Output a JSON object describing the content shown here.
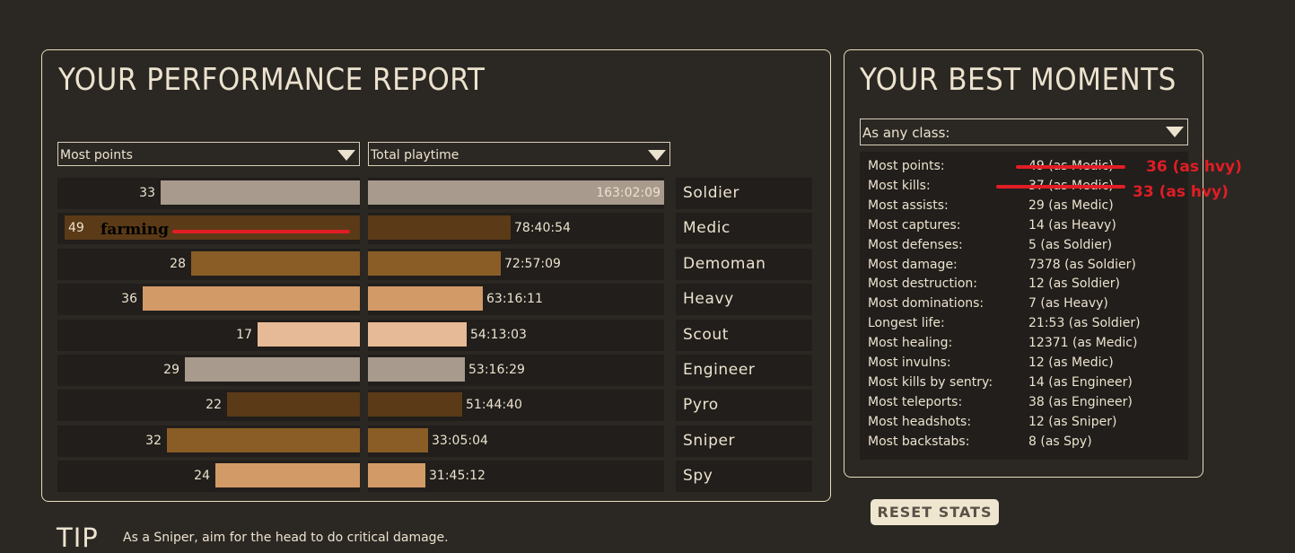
{
  "performance": {
    "title": "YOUR PERFORMANCE REPORT",
    "stat_dropdown": "Most points",
    "time_dropdown": "Total playtime",
    "rows": [
      {
        "class": "Soldier",
        "points": "33",
        "points_value": 33,
        "time": "163:02:09",
        "time_hours": 163.04,
        "color": "#a89a8c"
      },
      {
        "class": "Medic",
        "points": "49",
        "points_value": 49,
        "time": "78:40:54",
        "time_hours": 78.68,
        "color": "#5b3a17"
      },
      {
        "class": "Demoman",
        "points": "28",
        "points_value": 28,
        "time": "72:57:09",
        "time_hours": 72.95,
        "color": "#8a5d26"
      },
      {
        "class": "Heavy",
        "points": "36",
        "points_value": 36,
        "time": "63:16:11",
        "time_hours": 63.27,
        "color": "#d29a67"
      },
      {
        "class": "Scout",
        "points": "17",
        "points_value": 17,
        "time": "54:13:03",
        "time_hours": 54.22,
        "color": "#e6ba96"
      },
      {
        "class": "Engineer",
        "points": "29",
        "points_value": 29,
        "time": "53:16:29",
        "time_hours": 53.27,
        "color": "#a89a8c"
      },
      {
        "class": "Pyro",
        "points": "22",
        "points_value": 22,
        "time": "51:44:40",
        "time_hours": 51.74,
        "color": "#5b3a17"
      },
      {
        "class": "Sniper",
        "points": "32",
        "points_value": 32,
        "time": "33:05:04",
        "time_hours": 33.08,
        "color": "#8a5d26"
      },
      {
        "class": "Spy",
        "points": "24",
        "points_value": 24,
        "time": "31:45:12",
        "time_hours": 31.75,
        "color": "#d29a67"
      }
    ]
  },
  "moments": {
    "title": "YOUR BEST MOMENTS",
    "class_dropdown": "As any class:",
    "items": [
      {
        "label": "Most points:",
        "value": "49 (as Medic)"
      },
      {
        "label": "Most kills:",
        "value": "37 (as Medic)"
      },
      {
        "label": "Most assists:",
        "value": "29 (as Medic)"
      },
      {
        "label": "Most captures:",
        "value": "14 (as Heavy)"
      },
      {
        "label": "Most defenses:",
        "value": "5 (as Soldier)"
      },
      {
        "label": "Most damage:",
        "value": "7378 (as Soldier)"
      },
      {
        "label": "Most destruction:",
        "value": "12 (as Soldier)"
      },
      {
        "label": "Most dominations:",
        "value": "7 (as Heavy)"
      },
      {
        "label": "Longest life:",
        "value": "21:53 (as Soldier)"
      },
      {
        "label": "Most healing:",
        "value": "12371 (as Medic)"
      },
      {
        "label": "Most invulns:",
        "value": "12 (as Medic)"
      },
      {
        "label": "Most kills by sentry:",
        "value": "14 (as Engineer)"
      },
      {
        "label": "Most teleports:",
        "value": "38 (as Engineer)"
      },
      {
        "label": "Most headshots:",
        "value": "12 (as Sniper)"
      },
      {
        "label": "Most backstabs:",
        "value": "8 (as Spy)"
      }
    ]
  },
  "annotations": {
    "points_correction": "36 (as hvy)",
    "kills_correction": "33 (as hvy)",
    "medic_note": "farming",
    "color": "#e11d25"
  },
  "reset_label": "RESET STATS",
  "tip": {
    "heading": "TIP",
    "text": "As a Sniper, aim for the head to do critical damage."
  }
}
